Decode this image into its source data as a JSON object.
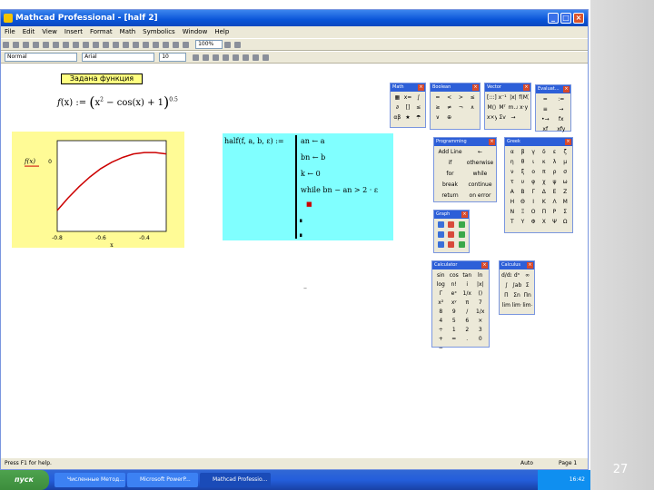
{
  "slide_number": "27",
  "window": {
    "title": "Mathcad Professional - [half 2]",
    "menu": [
      "File",
      "Edit",
      "View",
      "Insert",
      "Format",
      "Math",
      "Symbolics",
      "Window",
      "Help"
    ],
    "zoom": "100%",
    "style_select": "Normal",
    "font_select": "Arial",
    "size_select": "10"
  },
  "document": {
    "heading": "Задана функция",
    "formula": "f(x) := (x² − cos(x) + 1)^0.5",
    "plot_ylabel": "f(x)",
    "plot_xlabel": "x",
    "program": {
      "header": "half(f, a, b, ε) :=",
      "lines": [
        "an ← a",
        "bn ← b",
        "k ← 0",
        "while bn − an > 2 · ε"
      ],
      "placeholder": "■",
      "dots": [
        "∎",
        "∎"
      ]
    },
    "stray_mark": "–"
  },
  "chart_data": {
    "type": "line",
    "x": [
      -0.8,
      -0.75,
      -0.7,
      -0.65,
      -0.6,
      -0.55,
      -0.5,
      -0.45,
      -0.4,
      -0.35,
      -0.3
    ],
    "y": [
      -0.7,
      -0.52,
      -0.36,
      -0.22,
      -0.1,
      -0.01,
      0.06,
      0.11,
      0.13,
      0.13,
      0.11
    ],
    "xlim": [
      -0.8,
      -0.3
    ],
    "ylim": [
      -1.0,
      0.3
    ],
    "xticks": [
      "-0.8",
      "-0.6",
      "-0.4"
    ],
    "yticks": [
      "0"
    ],
    "ylabel": "f(x)",
    "xlabel": "x",
    "line_color": "#cc0000"
  },
  "palettes": [
    {
      "key": "math",
      "title": "Math",
      "cols": 3,
      "cells": [
        "▦",
        "x=",
        "∫",
        "∂",
        "[]",
        "≤",
        "αβ",
        "★",
        "☂"
      ]
    },
    {
      "key": "boolean",
      "title": "Boolean",
      "cols": 4,
      "cells": [
        "=",
        "<",
        ">",
        "≤",
        "≥",
        "≠",
        "¬",
        "∧",
        "∨",
        "⊕",
        "",
        ""
      ]
    },
    {
      "key": "vector",
      "title": "Vector",
      "cols": 4,
      "cells": [
        "[:::]",
        "x⁻¹",
        "|x|",
        "f(M)",
        "M⟨⟩",
        "Mᵀ",
        "m..n",
        "x·y",
        "x×y",
        "Σv",
        "→",
        ""
      ]
    },
    {
      "key": "evaluation",
      "title": "Evaluat...",
      "cols": 2,
      "cells": [
        "=",
        ":=",
        "≡",
        "→",
        "•→",
        "fx",
        "xf",
        "xfy"
      ]
    },
    {
      "key": "programming",
      "title": "Programming",
      "cols": 2,
      "cells": [
        "Add Line",
        "←",
        "if",
        "otherwise",
        "for",
        "while",
        "break",
        "continue",
        "return",
        "on error"
      ]
    },
    {
      "key": "greek",
      "title": "Greek",
      "cols": 6,
      "cells": [
        "α",
        "β",
        "γ",
        "δ",
        "ε",
        "ζ",
        "η",
        "θ",
        "ι",
        "κ",
        "λ",
        "μ",
        "ν",
        "ξ",
        "ο",
        "π",
        "ρ",
        "σ",
        "τ",
        "υ",
        "φ",
        "χ",
        "ψ",
        "ω",
        "Α",
        "Β",
        "Γ",
        "Δ",
        "Ε",
        "Ζ",
        "Η",
        "Θ",
        "Ι",
        "Κ",
        "Λ",
        "Μ",
        "Ν",
        "Ξ",
        "Ο",
        "Π",
        "Ρ",
        "Σ",
        "Τ",
        "Υ",
        "Φ",
        "Χ",
        "Ψ",
        "Ω"
      ]
    },
    {
      "key": "graph",
      "title": "Graph",
      "cols": 3,
      "cells": [
        "g1",
        "g2",
        "g3",
        "g4",
        "g5",
        "g6",
        "g7",
        "g8",
        "g9"
      ]
    },
    {
      "key": "calculator",
      "title": "Calculator",
      "cols": 4,
      "cells": [
        "sin",
        "cos",
        "tan",
        "ln",
        "log",
        "n!",
        "i",
        "|x|",
        "Γ",
        "eˣ",
        "1/x",
        "()",
        "x²",
        "xʸ",
        "π",
        "7",
        "8",
        "9",
        "/",
        "1/x",
        "4",
        "5",
        "6",
        "×",
        "÷",
        "1",
        "2",
        "3",
        "+",
        "=",
        ".",
        "0",
        "−"
      ]
    },
    {
      "key": "calculus",
      "title": "Calculus",
      "cols": 3,
      "cells": [
        "d/dx",
        "dⁿ",
        "∞",
        "∫",
        "∫ab",
        "Σ",
        "Π",
        "Σn",
        "Πn",
        "lim",
        "lim+",
        "lim−"
      ]
    }
  ],
  "status": {
    "help": "Press F1 for help.",
    "mode": "Auto",
    "page": "Page 1"
  },
  "taskbar": {
    "start": "пуск",
    "tasks": [
      "Численные Метод...",
      "Microsoft PowerP...",
      "Mathcad Professio..."
    ],
    "clock": "16:42"
  }
}
